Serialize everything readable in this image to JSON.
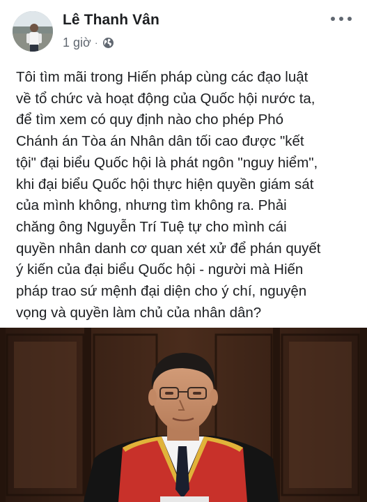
{
  "post": {
    "author": "Lê Thanh Vân",
    "time": "1 giờ",
    "separator": "·",
    "privacy_icon": "globe-icon",
    "more_icon": "more-options-icon",
    "body": "Tôi tìm mãi trong Hiến pháp cùng các đạo luật\nvề tổ chức và hoạt động của Quốc hội nước ta,\nđể tìm xem có quy định nào cho phép Phó\nChánh án Tòa án Nhân dân tối cao được \"kết\ntội\" đại biểu Quốc hội là phát ngôn \"nguy hiểm\",\nkhi đại biểu Quốc hội thực hiện quyền giám sát\ncủa mình không, nhưng tìm không ra. Phải\nchăng ông Nguyễn Trí Tuệ tự cho mình cái\nquyền nhân danh cơ quan xét xử để phán quyết\ný kiến của đại biểu Quốc hội - người mà Hiến\npháp trao sứ mệnh đại diện cho ý chí, nguyện\nvọng và quyền làm chủ của nhân dân?"
  },
  "colors": {
    "text": "#1c1e21",
    "meta": "#606770",
    "robe_red": "#c8312a",
    "robe_black": "#141414",
    "wood_dark": "#3b2418"
  }
}
